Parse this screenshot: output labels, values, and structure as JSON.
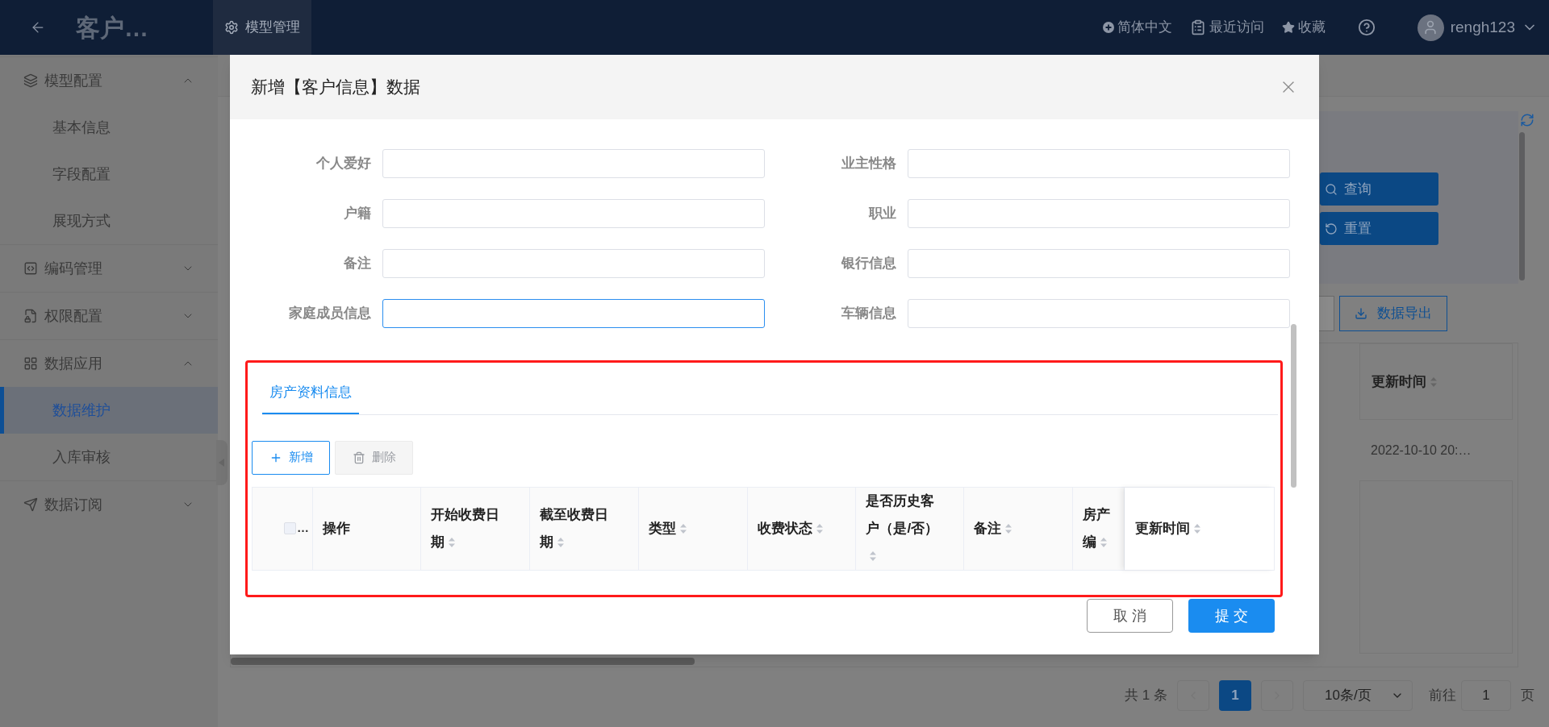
{
  "topbar": {
    "title": "客户…",
    "tabs": [
      {
        "label": "模型管理",
        "selected": true
      }
    ],
    "language": "简体中文",
    "recent": "最近访问",
    "favorites": "收藏",
    "user": "rengh123"
  },
  "sidebar": {
    "items": [
      {
        "label": "模型配置",
        "expanded": true,
        "children": [
          {
            "label": "基本信息",
            "selected": false
          },
          {
            "label": "字段配置",
            "selected": false
          },
          {
            "label": "展现方式",
            "selected": false
          }
        ]
      },
      {
        "label": "编码管理",
        "expanded": false
      },
      {
        "label": "权限配置",
        "expanded": false
      },
      {
        "label": "数据应用",
        "expanded": true,
        "children": [
          {
            "label": "数据维护",
            "selected": true
          },
          {
            "label": "入库审核",
            "selected": false
          }
        ]
      },
      {
        "label": "数据订阅",
        "expanded": false
      }
    ]
  },
  "background": {
    "search_buttons": [
      {
        "label": "查询",
        "kind": "search"
      },
      {
        "label": "重置",
        "kind": "reset"
      }
    ],
    "export_button": "数据导出",
    "table": {
      "columns": [
        "更新时间"
      ],
      "rows": [
        [
          "2022-10-10 20:…"
        ]
      ]
    },
    "pagination": {
      "total": "共 1 条",
      "pages": [
        {
          "label": "1",
          "selected": true
        }
      ],
      "page_size": "10条/页",
      "goto_label": "前往",
      "goto_value": "1",
      "goto_unit": "页"
    }
  },
  "modal": {
    "title": "新增【客户信息】数据",
    "fields": [
      {
        "label": "个人爱好",
        "focused": false
      },
      {
        "label": "业主性格",
        "focused": false
      },
      {
        "label": "户籍",
        "focused": false
      },
      {
        "label": "职业",
        "focused": false
      },
      {
        "label": "备注",
        "focused": false
      },
      {
        "label": "银行信息",
        "focused": false
      },
      {
        "label": "家庭成员信息",
        "focused": true
      },
      {
        "label": "车辆信息",
        "focused": false
      }
    ],
    "subform": {
      "tabs": [
        {
          "label": "房产资料信息",
          "selected": true
        }
      ],
      "buttons": [
        {
          "label": "新增",
          "kind": "add",
          "disabled": false
        },
        {
          "label": "删除",
          "kind": "delete",
          "disabled": true
        }
      ],
      "select_all": {
        "checked": false,
        "text": "…"
      },
      "columns": [
        {
          "label": "操作",
          "sortable": false
        },
        {
          "label": "开始收费日期",
          "sortable": true
        },
        {
          "label": "截至收费日期",
          "sortable": true
        },
        {
          "label": "类型",
          "sortable": true
        },
        {
          "label": "收费状态",
          "sortable": true
        },
        {
          "label": "是否历史客户（是/否）",
          "sortable": true
        },
        {
          "label": "备注",
          "sortable": true
        },
        {
          "label": "房产编",
          "sortable": true
        },
        {
          "label": "更新时间",
          "sortable": true
        }
      ]
    },
    "footer_buttons": [
      {
        "label": "取 消",
        "kind": "cancel"
      },
      {
        "label": "提 交",
        "kind": "submit"
      }
    ]
  }
}
